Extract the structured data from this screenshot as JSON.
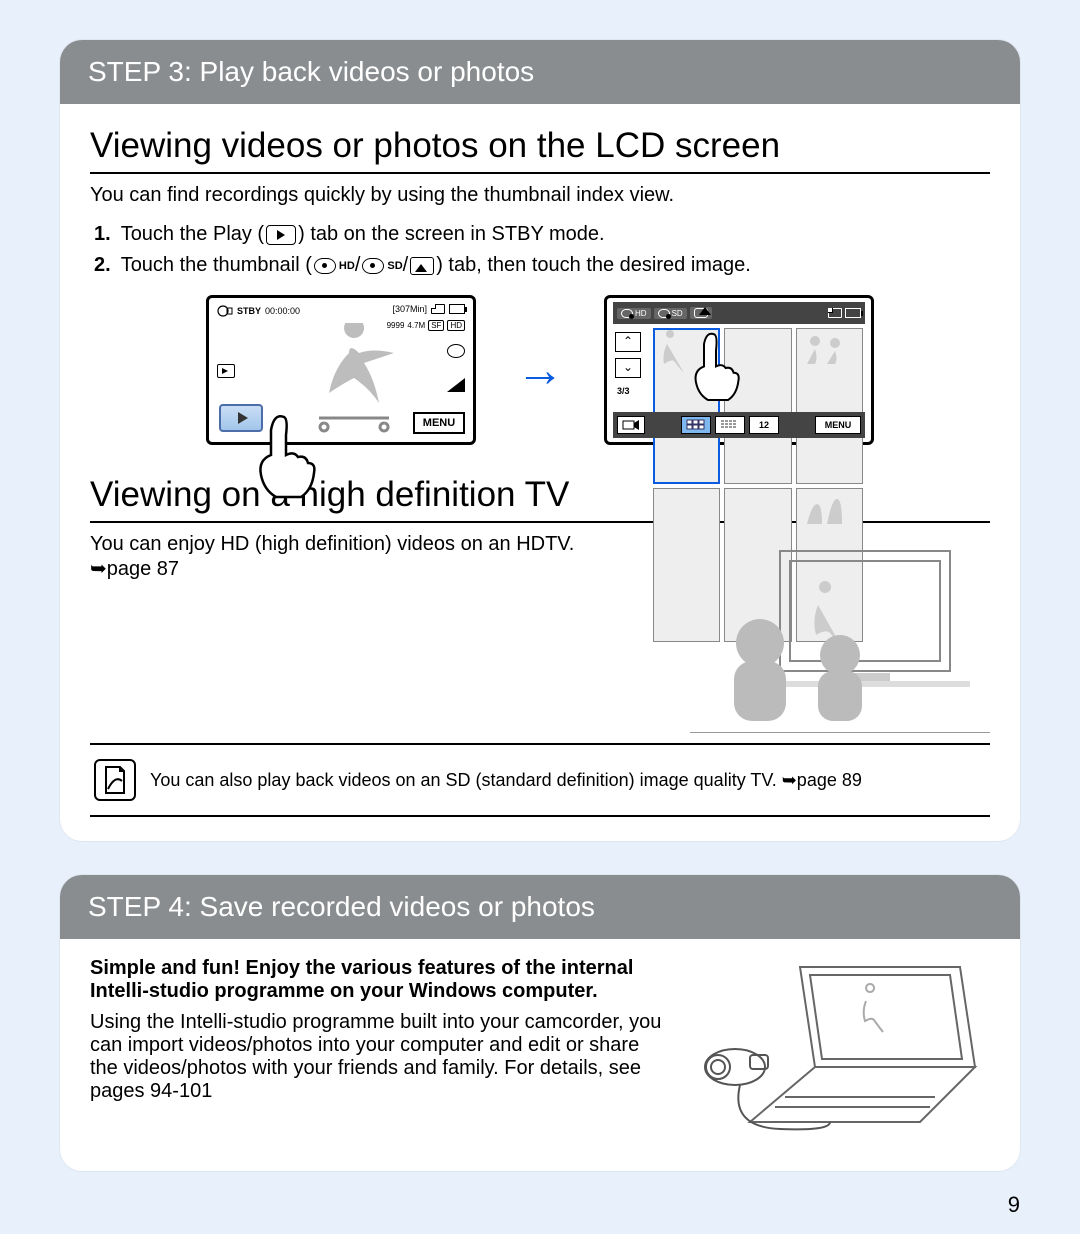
{
  "page_number": "9",
  "card1": {
    "header": "STEP 3: Play back videos or photos",
    "section1_heading": "Viewing videos or photos on the LCD screen",
    "section1_lede": "You can find recordings quickly by using the thumbnail index view.",
    "step1_num": "1.",
    "step1_a": "Touch the Play (",
    "step1_b": ") tab on the screen in STBY mode.",
    "step2_num": "2.",
    "step2_a": "Touch the thumbnail (",
    "step2_hd": "HD",
    "step2_slash1": " /",
    "step2_sd": "SD",
    "step2_slash2": " /",
    "step2_b": ") tab, then touch the desired image.",
    "lcd1": {
      "stby": "STBY",
      "time": "00:00:00",
      "remain": "[307Min]",
      "resolution": "9999",
      "mp": "4.7M",
      "menu": "MENU"
    },
    "lcd2": {
      "tab_hd": "HD",
      "tab_sd": "SD",
      "page": "3/3",
      "up": "⌃",
      "down": "⌄",
      "count": "12",
      "menu": "MENU"
    },
    "section2_heading": "Viewing on a high definition TV",
    "section2_text": "You can enjoy HD (high definition) videos on an HDTV.",
    "section2_pageref": "➥page 87",
    "note_text": "You can also play back videos on an SD (standard definition) image quality TV. ➥page 89"
  },
  "card2": {
    "header": "STEP 4: Save recorded videos or photos",
    "bold": "Simple and fun! Enjoy the various features of the internal Intelli-studio programme on your Windows computer.",
    "body": "Using the Intelli-studio programme built into your camcorder, you can import videos/photos into your computer and edit or share the videos/photos with your friends and family. For details, see pages 94-101"
  }
}
